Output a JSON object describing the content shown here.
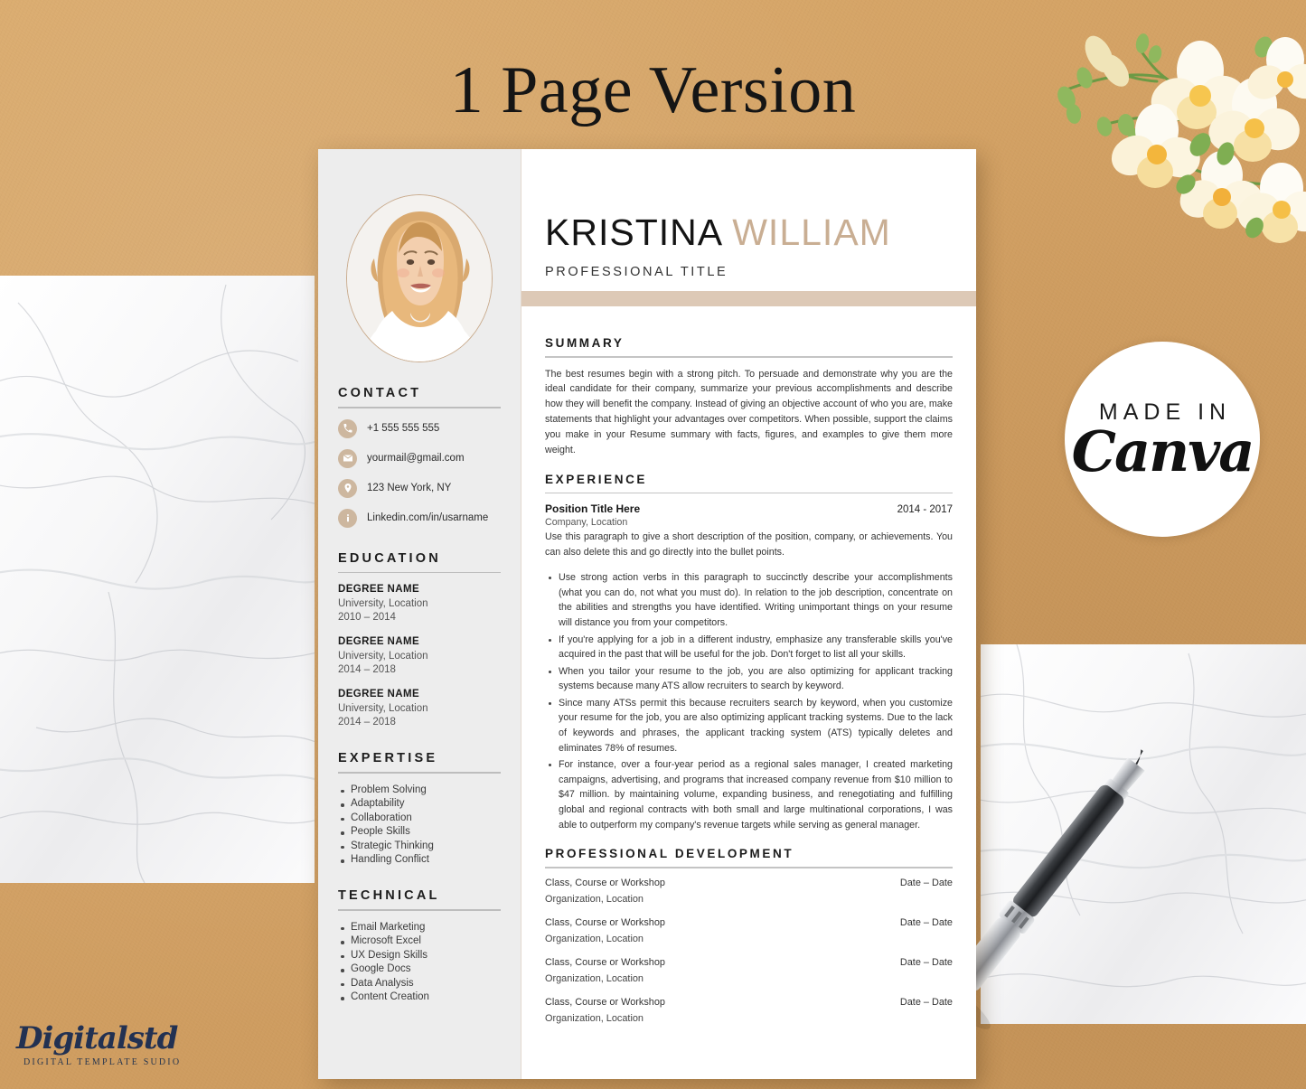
{
  "headline": "1 Page Version",
  "badge": {
    "made_in": "MADE IN",
    "brand": "Canva"
  },
  "logo": {
    "brand": "Digitalstd",
    "tagline": "DIGITAL TEMPLATE SUDIO"
  },
  "resume": {
    "name_first": "KRISTINA",
    "name_last": "WILLIAM",
    "job_title": "PROFESSIONAL TITLE",
    "sidebar": {
      "contact_heading": "CONTACT",
      "contact": [
        {
          "icon": "phone-icon",
          "value": "+1 555 555 555"
        },
        {
          "icon": "envelope-icon",
          "value": "yourmail@gmail.com"
        },
        {
          "icon": "location-pin-icon",
          "value": "123 New York, NY"
        },
        {
          "icon": "info-icon",
          "value": "Linkedin.com/in/usarname"
        }
      ],
      "education_heading": "EDUCATION",
      "education": [
        {
          "degree": "DEGREE NAME",
          "school": "University, Location",
          "dates": "2010 – 2014"
        },
        {
          "degree": "DEGREE NAME",
          "school": "University, Location",
          "dates": "2014 – 2018"
        },
        {
          "degree": "DEGREE NAME",
          "school": "University, Location",
          "dates": "2014 – 2018"
        }
      ],
      "expertise_heading": "EXPERTISE",
      "expertise": [
        "Problem Solving",
        "Adaptability",
        "Collaboration",
        "People Skills",
        "Strategic Thinking",
        "Handling Conflict"
      ],
      "technical_heading": "TECHNICAL",
      "technical": [
        "Email Marketing",
        "Microsoft Excel",
        "UX Design Skills",
        "Google Docs",
        "Data Analysis",
        "Content Creation"
      ]
    },
    "summary_heading": "SUMMARY",
    "summary_text": "The best resumes begin with a strong pitch. To persuade and demonstrate why you are the ideal candidate for their company, summarize your previous accomplishments and describe how they will benefit the company. Instead of giving an objective account of who you are, make statements that highlight your advantages over competitors. When possible, support the claims you make in your Resume summary with facts, figures, and examples to give them more weight.",
    "experience_heading": "EXPERIENCE",
    "job": {
      "title": "Position Title Here",
      "dates": "2014 - 2017",
      "company": "Company, Location",
      "description": "Use this paragraph to give a short description of the position, company, or achievements. You can also delete this and go directly into the bullet points.",
      "bullets": [
        "Use strong action verbs in this paragraph to succinctly describe your accomplishments      (what you can do, not what you must do). In relation to the job description, concentrate on the abilities and strengths you have identified. Writing unimportant things on your resume will distance you from your competitors.",
        "If you're applying for a job in a different industry, emphasize any transferable skills you've acquired in the past that will be useful for the job. Don't forget to list all your skills.",
        "When you tailor your resume to the job, you are also optimizing for applicant tracking systems because many ATS allow recruiters to search by keyword.",
        "Since many ATSs permit this because recruiters search by keyword, when you customize your resume for the job, you are also optimizing applicant tracking systems. Due to the lack of keywords and phrases, the applicant tracking system (ATS) typically deletes and eliminates 78% of resumes.",
        "For instance, over a four-year period as a regional sales manager, I created marketing campaigns, advertising, and programs that increased company revenue from $10 million to $47 million. by maintaining volume, expanding business, and renegotiating and fulfilling global and regional contracts with both small and large multinational corporations, I was able to outperform my company's revenue targets while serving as general manager."
      ]
    },
    "prof_dev_heading": "PROFESSIONAL DEVELOPMENT",
    "prof_dev": [
      {
        "title": "Class, Course or Workshop",
        "org": "Organization, Location",
        "dates": "Date – Date"
      },
      {
        "title": "Class, Course or Workshop",
        "org": "Organization, Location",
        "dates": "Date – Date"
      },
      {
        "title": "Class, Course or Workshop",
        "org": "Organization, Location",
        "dates": "Date – Date"
      },
      {
        "title": "Class, Course or Workshop",
        "org": "Organization, Location",
        "dates": "Date – Date"
      }
    ]
  },
  "colors": {
    "background_tan": "#d2a063",
    "accent_tan": "#ddc9b6",
    "name_accent": "#c9ae93",
    "sidebar_grey": "#ededed",
    "icon_tan": "#cdb79f"
  }
}
